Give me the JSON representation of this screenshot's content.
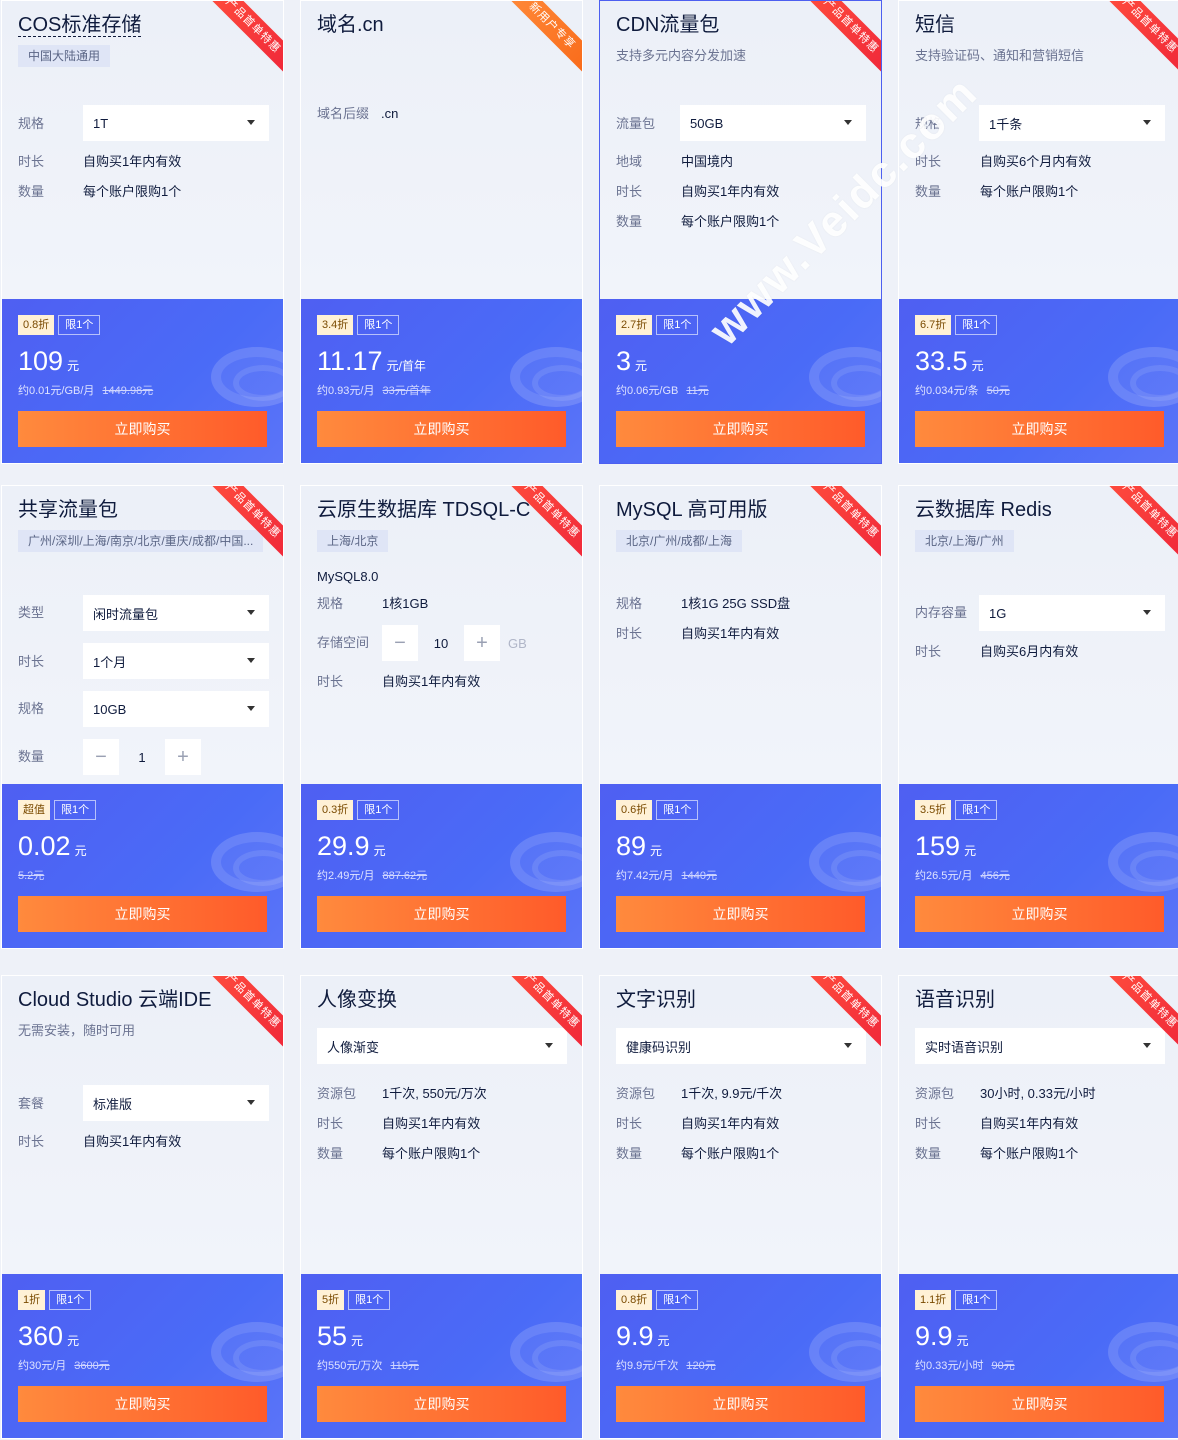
{
  "buy_label": "立即购买",
  "watermark": "www.Veidc.com",
  "products": [
    {
      "title": "COS标准存储",
      "tag": "中国大陆通用",
      "ribbon": "产品首单特惠",
      "specs": [
        {
          "label": "规格",
          "value": "1T"
        },
        {
          "label": "时长",
          "value": "自购买1年内有效"
        },
        {
          "label": "数量",
          "value": "每个账户限购1个"
        }
      ],
      "discount": "0.8折",
      "limit": "限1个",
      "price": "109",
      "unit": "元",
      "per": "约0.01元/GB/月",
      "original": "1449.98元"
    },
    {
      "title": "域名.cn",
      "ribbon": "新用户专享",
      "domain_label": "域名后缀",
      "domain_value": ".cn",
      "discount": "3.4折",
      "limit": "限1个",
      "price": "11.17",
      "unit": "元/首年",
      "per": "约0.93元/月",
      "original": "33元/首年"
    },
    {
      "title": "CDN流量包",
      "subtitle": "支持多元内容分发加速",
      "ribbon": "产品首单特惠",
      "specs": [
        {
          "label": "流量包",
          "value": "50GB"
        },
        {
          "label": "地域",
          "value": "中国境内"
        },
        {
          "label": "时长",
          "value": "自购买1年内有效"
        },
        {
          "label": "数量",
          "value": "每个账户限购1个"
        }
      ],
      "discount": "2.7折",
      "limit": "限1个",
      "price": "3",
      "unit": "元",
      "per": "约0.06元/GB",
      "original": "11元"
    },
    {
      "title": "短信",
      "subtitle": "支持验证码、通知和营销短信",
      "ribbon": "产品首单特惠",
      "specs": [
        {
          "label": "规格",
          "value": "1千条"
        },
        {
          "label": "时长",
          "value": "自购买6个月内有效"
        },
        {
          "label": "数量",
          "value": "每个账户限购1个"
        }
      ],
      "discount": "6.7折",
      "limit": "限1个",
      "price": "33.5",
      "unit": "元",
      "per": "约0.034元/条",
      "original": "50元"
    },
    {
      "title": "共享流量包",
      "tag": "广州/深圳/上海/南京/北京/重庆/成都/中国...",
      "ribbon": "产品首单特惠",
      "specs": [
        {
          "label": "类型",
          "value": "闲时流量包"
        },
        {
          "label": "时长",
          "value": "1个月"
        },
        {
          "label": "规格",
          "value": "10GB"
        },
        {
          "label": "数量",
          "value": "1"
        }
      ],
      "discount": "超值",
      "limit": "限1个",
      "price": "0.02",
      "unit": "元",
      "per": "",
      "original": "5.2元"
    },
    {
      "title": "云原生数据库 TDSQL-C",
      "tag": "上海/北京",
      "ribbon": "产品首单特惠",
      "version": "MySQL8.0",
      "specs": [
        {
          "label": "规格",
          "value": "1核1GB"
        },
        {
          "label": "存储空间",
          "value": "10",
          "unit": "GB"
        },
        {
          "label": "时长",
          "value": "自购买1年内有效"
        }
      ],
      "discount": "0.3折",
      "limit": "限1个",
      "price": "29.9",
      "unit": "元",
      "per": "约2.49元/月",
      "original": "887.62元"
    },
    {
      "title": "MySQL 高可用版",
      "tag": "北京/广州/成都/上海",
      "ribbon": "产品首单特惠",
      "specs": [
        {
          "label": "规格",
          "value": "1核1G 25G SSD盘"
        },
        {
          "label": "时长",
          "value": "自购买1年内有效"
        }
      ],
      "discount": "0.6折",
      "limit": "限1个",
      "price": "89",
      "unit": "元",
      "per": "约7.42元/月",
      "original": "1440元"
    },
    {
      "title": "云数据库 Redis",
      "tag": "北京/上海/广州",
      "ribbon": "产品首单特惠",
      "specs": [
        {
          "label": "内存容量",
          "value": "1G"
        },
        {
          "label": "时长",
          "value": "自购买6月内有效"
        }
      ],
      "discount": "3.5折",
      "limit": "限1个",
      "price": "159",
      "unit": "元",
      "per": "约26.5元/月",
      "original": "456元"
    },
    {
      "title": "Cloud Studio 云端IDE",
      "subtitle": "无需安装，随时可用",
      "ribbon": "产品首单特惠",
      "specs": [
        {
          "label": "套餐",
          "value": "标准版"
        },
        {
          "label": "时长",
          "value": "自购买1年内有效"
        }
      ],
      "discount": "1折",
      "limit": "限1个",
      "price": "360",
      "unit": "元",
      "per": "约30元/月",
      "original": "3600元"
    },
    {
      "title": "人像变换",
      "select": "人像渐变",
      "ribbon": "产品首单特惠",
      "specs": [
        {
          "label": "资源包",
          "value": "1千次, 550元/万次"
        },
        {
          "label": "时长",
          "value": "自购买1年内有效"
        },
        {
          "label": "数量",
          "value": "每个账户限购1个"
        }
      ],
      "discount": "5折",
      "limit": "限1个",
      "price": "55",
      "unit": "元",
      "per": "约550元/万次",
      "original": "110元"
    },
    {
      "title": "文字识别",
      "select": "健康码识别",
      "ribbon": "产品首单特惠",
      "specs": [
        {
          "label": "资源包",
          "value": "1千次, 9.9元/千次"
        },
        {
          "label": "时长",
          "value": "自购买1年内有效"
        },
        {
          "label": "数量",
          "value": "每个账户限购1个"
        }
      ],
      "discount": "0.8折",
      "limit": "限1个",
      "price": "9.9",
      "unit": "元",
      "per": "约9.9元/千次",
      "original": "120元"
    },
    {
      "title": "语音识别",
      "select": "实时语音识别",
      "ribbon": "产品首单特惠",
      "specs": [
        {
          "label": "资源包",
          "value": "30小时, 0.33元/小时"
        },
        {
          "label": "时长",
          "value": "自购买1年内有效"
        },
        {
          "label": "数量",
          "value": "每个账户限购1个"
        }
      ],
      "discount": "1.1折",
      "limit": "限1个",
      "price": "9.9",
      "unit": "元",
      "per": "约0.33元/小时",
      "original": "90元"
    }
  ]
}
